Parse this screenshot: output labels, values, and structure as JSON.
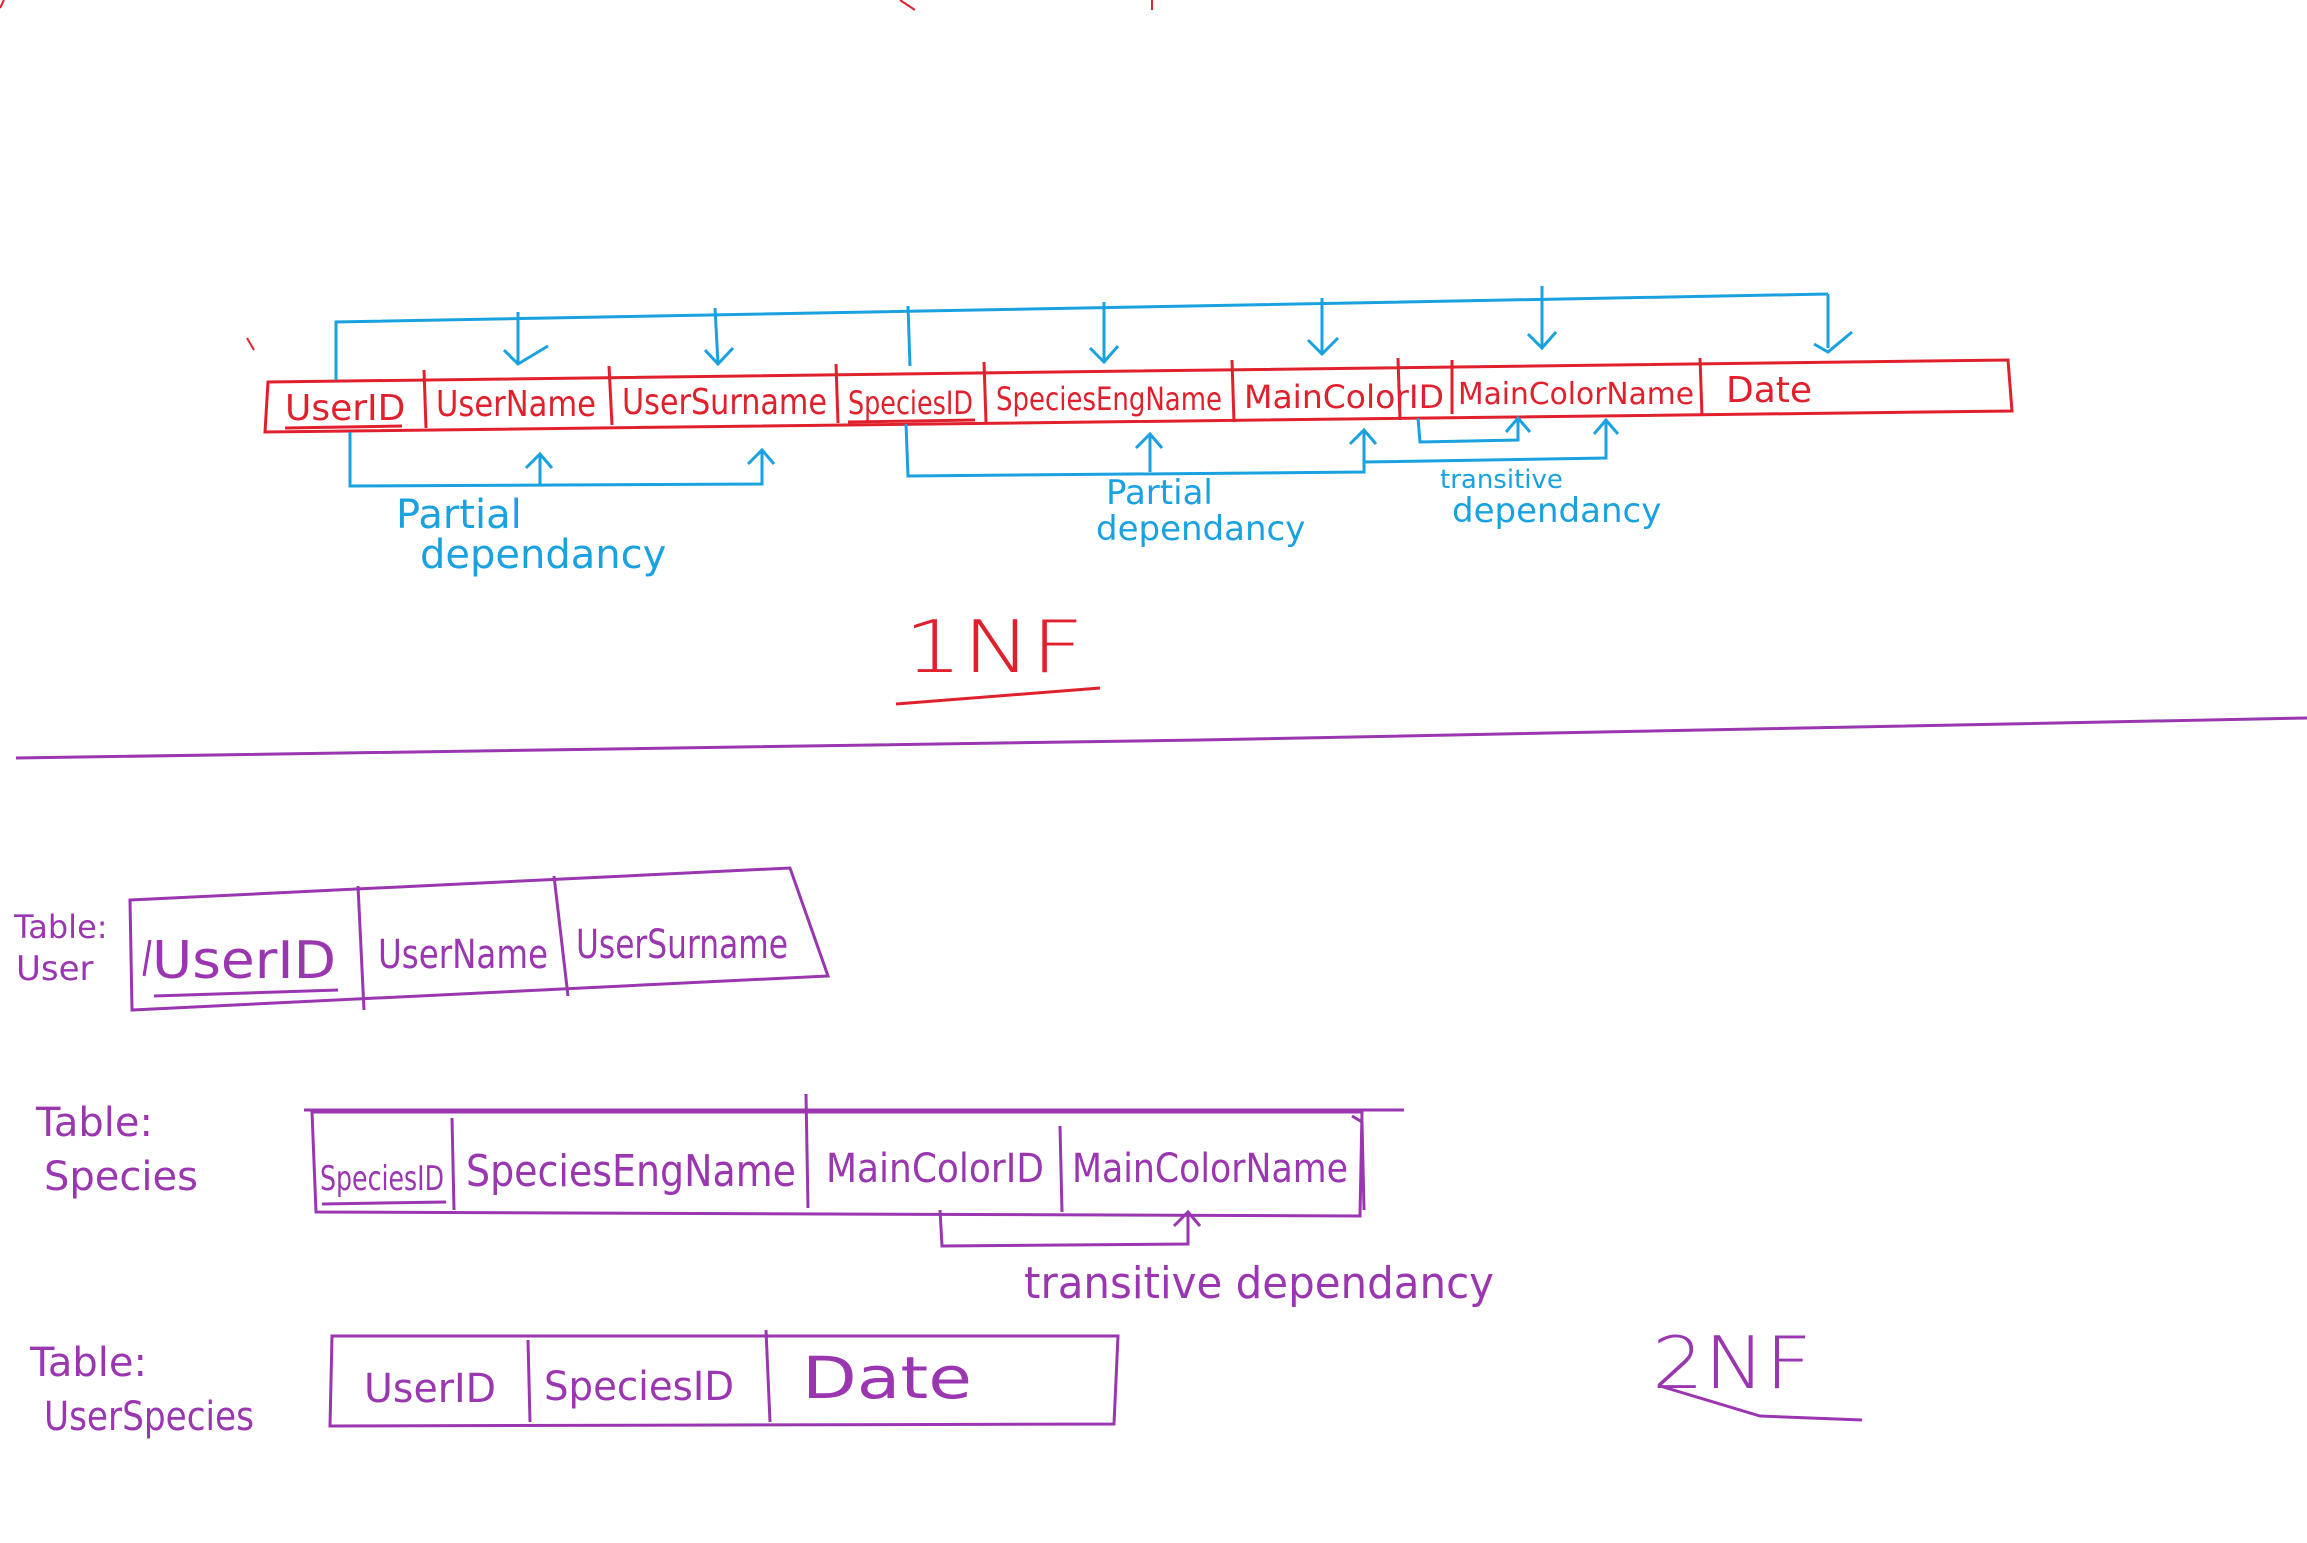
{
  "colors": {
    "red": "#e0212d",
    "blue": "#1aa1e0",
    "purple": "#9a36b0"
  },
  "one_nf": {
    "label": "1NF",
    "columns": [
      "UserID",
      "UserName",
      "UserSurname",
      "SpeciesID",
      "SpeciesEngName",
      "MainColorID",
      "MainColorName",
      "Date"
    ],
    "annotations": {
      "partial_left": [
        "Partial",
        "dependancy"
      ],
      "partial_mid": [
        "Partial",
        "dependancy"
      ],
      "transitive": [
        "transitive",
        "dependancy"
      ]
    }
  },
  "two_nf": {
    "label": "2NF",
    "tables": [
      {
        "label": [
          "Table:",
          "User"
        ],
        "columns": [
          "UserID",
          "UserName",
          "UserSurname"
        ]
      },
      {
        "label": [
          "Table:",
          "Species"
        ],
        "columns": [
          "SpeciesID",
          "SpeciesEngName",
          "MainColorID",
          "MainColorName"
        ]
      },
      {
        "label": [
          "Table:",
          "UserSpecies"
        ],
        "columns": [
          "UserID",
          "SpeciesID",
          "Date"
        ]
      }
    ],
    "transitive_note": "transitive dependancy"
  }
}
